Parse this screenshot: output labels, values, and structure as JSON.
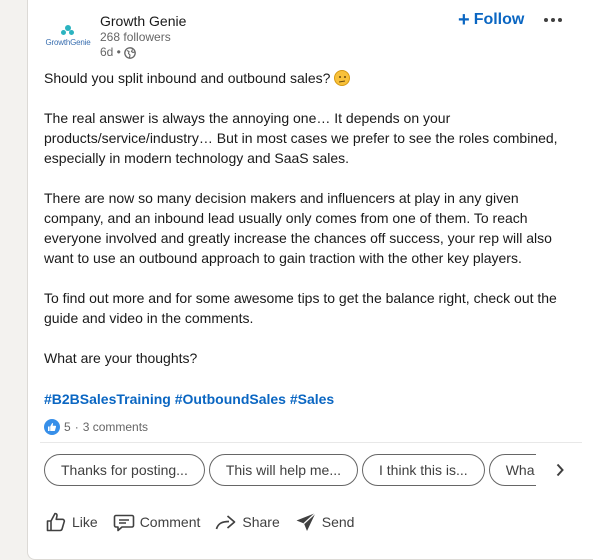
{
  "post": {
    "company_name": "Growth Genie",
    "followers": "268 followers",
    "time": "6d •",
    "logo_text": "GrowthGenie",
    "follow_label": "Follow",
    "follow_plus": "+",
    "more_icon": "ellipsis-icon",
    "paragraphs": [
      "Should you split inbound and outbound sales?",
      "The real answer is always the annoying one… It depends on your products/service/industry… But in most cases we prefer to see the roles combined, especially in modern technology and SaaS sales.",
      "There are now so many decision makers and influencers at play in any given company, and an inbound lead usually only comes from one of them. To reach everyone involved and greatly increase the chances off success, your rep will also want to use an outbound approach to gain traction with the other key players.",
      "To find out more and for some awesome tips to get the balance right, check out the guide and video in the comments.",
      "What are your thoughts?"
    ],
    "hashtags": [
      "#B2BSalesTraining",
      "#OutboundSales",
      "#Sales"
    ],
    "reactions": "5",
    "separator": "·",
    "comments": "3 comments"
  },
  "suggestions": [
    "Thanks for posting...",
    "This will help me...",
    "I think this is...",
    "Wha"
  ],
  "actions": {
    "like": "Like",
    "comment": "Comment",
    "share": "Share",
    "send": "Send"
  },
  "colors": {
    "accent": "#0a66c2",
    "reaction_blue": "#378fe9",
    "text_secondary": "#666666"
  }
}
